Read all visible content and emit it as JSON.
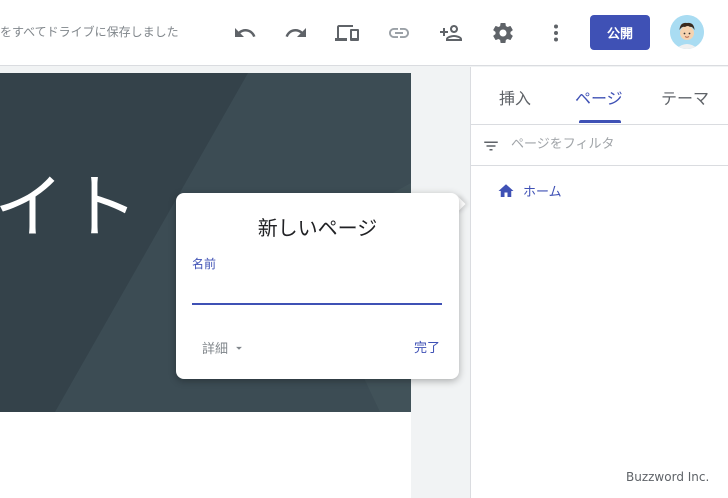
{
  "topbar": {
    "save_status": "をすべてドライブに保存しました",
    "publish_label": "公開",
    "icons": [
      "undo-icon",
      "redo-icon",
      "preview-device-icon",
      "link-icon",
      "add-person-icon",
      "settings-icon",
      "more-vert-icon"
    ]
  },
  "hero": {
    "title": "イト"
  },
  "popup": {
    "title": "新しいページ",
    "name_label": "名前",
    "name_value": "",
    "details_label": "詳細",
    "done_label": "完了"
  },
  "panel": {
    "tabs": [
      {
        "label": "挿入",
        "active": false
      },
      {
        "label": "ページ",
        "active": true
      },
      {
        "label": "テーマ",
        "active": false
      }
    ],
    "filter_placeholder": "ページをフィルタ",
    "pages": [
      {
        "label": "ホーム",
        "icon": "home-icon"
      }
    ]
  },
  "watermark": "Buzzword Inc.",
  "colors": {
    "accent": "#3f51b5",
    "hero_bg": "#38474e",
    "icon_gray": "#5f6368"
  }
}
